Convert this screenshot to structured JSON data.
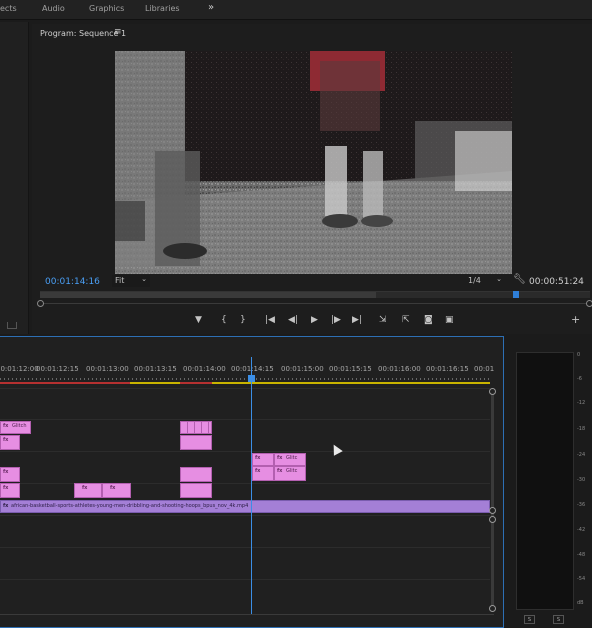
{
  "workspaces": {
    "effects": "ects",
    "audio": "Audio",
    "graphics": "Graphics",
    "libraries": "Libraries",
    "more": "»"
  },
  "program_monitor": {
    "title": "Program: Sequence 1",
    "menu": "≡",
    "current_timecode": "00:01:14:16",
    "fit": "Fit",
    "resolution": "1/4",
    "duration": "00:00:51:24",
    "playback_progress": 0.61
  },
  "transport": {
    "marker": "▼",
    "in": "{",
    "out": "}",
    "go_in": "|◀",
    "step_back": "◀|",
    "play": "▶",
    "step_forward": "|▶",
    "go_out": "▶|",
    "insert": "⇲",
    "overwrite": "⇱",
    "export_frame": "◙",
    "compare": "▣",
    "add": "+"
  },
  "timeline": {
    "ruler": [
      "00:01:12:00",
      "00:01:12:15",
      "00:01:13:00",
      "00:01:13:15",
      "00:01:14:00",
      "00:01:14:15",
      "00:01:15:00",
      "00:01:15:15",
      "00:01:16:00",
      "00:01:16:15",
      "00:01"
    ],
    "clips": {
      "glitch_1": "Glitch",
      "glitch_2": "Glitc",
      "glitch_3": "Glitc",
      "fx": "fx",
      "long_name": "african-basketball-sports-athletes-young-men-dribbling-and-shooting-hoops_bpus_nov_4k.mp4"
    }
  },
  "meter": {
    "db_labels": [
      "0",
      "-6",
      "-12",
      "-18",
      "-24",
      "-30",
      "-36",
      "-42",
      "-48",
      "-54",
      "dB"
    ],
    "solo_left": "S",
    "solo_right": "S"
  },
  "colors": {
    "accent": "#4a9ff5",
    "clip_pink": "#e68ee2",
    "clip_purple": "#a47fd6"
  }
}
